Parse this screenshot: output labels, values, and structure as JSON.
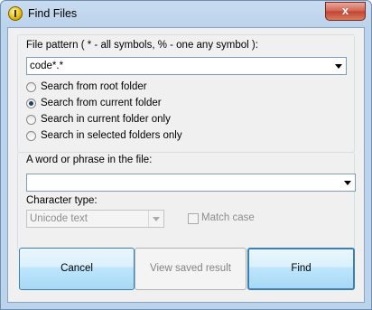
{
  "window": {
    "title": "Find Files",
    "close_glyph": "x"
  },
  "pattern": {
    "label": "File pattern ( * - all symbols, % - one any symbol ):",
    "value": "code*.*"
  },
  "search_options": [
    {
      "label": "Search from root folder",
      "selected": false
    },
    {
      "label": "Search from current folder",
      "selected": true
    },
    {
      "label": "Search in current folder only",
      "selected": false
    },
    {
      "label": "Search in selected folders only",
      "selected": false
    }
  ],
  "phrase": {
    "label": "A word or phrase in the file:",
    "value": ""
  },
  "charset": {
    "label": "Character type:",
    "value": "Unicode text"
  },
  "match_case": {
    "label": "Match case",
    "checked": false
  },
  "buttons": {
    "cancel": "Cancel",
    "view_saved": "View saved result",
    "find": "Find"
  }
}
